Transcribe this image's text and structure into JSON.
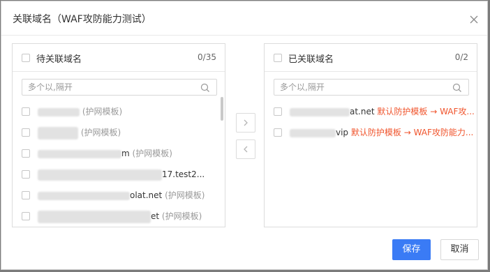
{
  "dialog": {
    "title": "关联域名（WAF攻防能力测试）",
    "save_label": "保存",
    "cancel_label": "取消"
  },
  "left_panel": {
    "title": "待关联域名",
    "count": "0/35",
    "search_placeholder": "多个以,隔开",
    "items": [
      {
        "visible": "",
        "tag": "(护网模板)"
      },
      {
        "visible": "",
        "tag": "(护网模板)"
      },
      {
        "visible": "m",
        "tag": "(护网模板)"
      },
      {
        "visible": "17.test2...",
        "tag": ""
      },
      {
        "visible": "olat.net",
        "tag": "(护网模板)"
      },
      {
        "visible": "et",
        "tag": "(护网模板)"
      }
    ]
  },
  "right_panel": {
    "title": "已关联域名",
    "count": "0/2",
    "search_placeholder": "多个以,隔开",
    "items": [
      {
        "visible": "at.net",
        "template": "默认防护模板 → WAF攻..."
      },
      {
        "visible": "vip",
        "template": "默认防护模板 → WAF攻防能力..."
      }
    ]
  },
  "icons": {
    "close": "close-icon",
    "search": "search-icon",
    "move_right": "chevron-right-icon",
    "move_left": "chevron-left-icon"
  },
  "colors": {
    "primary": "#3a7bf5",
    "template_text": "#f0542c"
  }
}
